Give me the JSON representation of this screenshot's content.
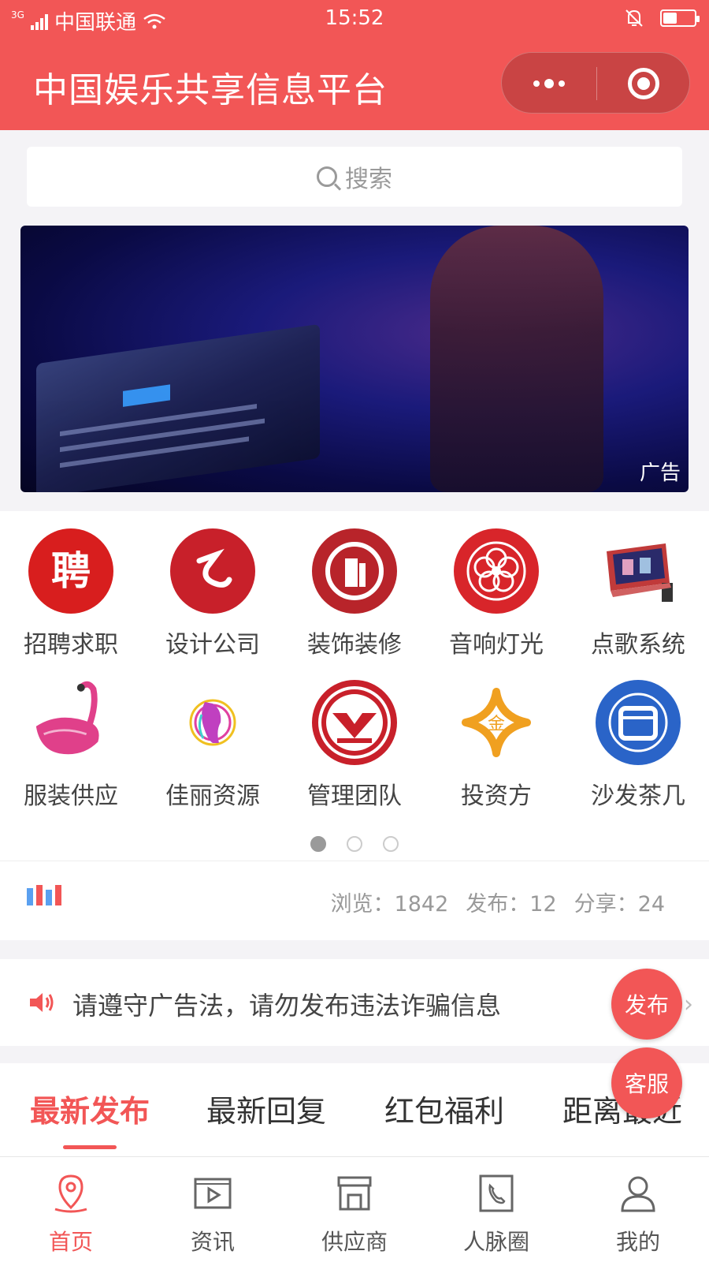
{
  "status_bar": {
    "network": "3G",
    "carrier": "中国联通",
    "time": "15:52",
    "battery_level": 0.45
  },
  "header": {
    "title": "中国娱乐共享信息平台",
    "menu_icon": "more-dots-icon",
    "close_icon": "target-icon"
  },
  "search": {
    "placeholder": "搜索"
  },
  "banner": {
    "ad_label": "广告"
  },
  "categories": [
    {
      "label": "招聘求职",
      "icon": "recruit-icon",
      "color": "#d81e1e"
    },
    {
      "label": "设计公司",
      "icon": "design-icon",
      "color": "#c8202a"
    },
    {
      "label": "装饰装修",
      "icon": "decoration-icon",
      "color": "#b8242a"
    },
    {
      "label": "音响灯光",
      "icon": "flower-icon",
      "color": "#d8252a"
    },
    {
      "label": "点歌系统",
      "icon": "karaoke-icon",
      "color": "#c03a3a"
    },
    {
      "label": "服装供应",
      "icon": "flamingo-icon",
      "color": "#e0408a"
    },
    {
      "label": "佳丽资源",
      "icon": "girl-icon",
      "color": "#c040c0"
    },
    {
      "label": "管理团队",
      "icon": "team-icon",
      "color": "#c8202a"
    },
    {
      "label": "投资方",
      "icon": "invest-icon",
      "color": "#f0a020"
    },
    {
      "label": "沙发茶几",
      "icon": "sofa-icon",
      "color": "#2a64c8"
    }
  ],
  "pager": {
    "total": 3,
    "current": 1
  },
  "stats": {
    "views": "浏览：1842",
    "posts": "发布：12",
    "shares": "分享：24"
  },
  "notice": {
    "text": "请遵守广告法，请勿发布违法诈骗信息"
  },
  "tabs": [
    {
      "label": "最新发布",
      "active": true
    },
    {
      "label": "最新回复",
      "active": false
    },
    {
      "label": "红包福利",
      "active": false
    },
    {
      "label": "距离最近",
      "active": false
    }
  ],
  "fab": {
    "publish": "发布",
    "service": "客服"
  },
  "bottom_nav": [
    {
      "label": "首页",
      "icon": "location-icon",
      "active": true
    },
    {
      "label": "资讯",
      "icon": "video-icon",
      "active": false
    },
    {
      "label": "供应商",
      "icon": "store-icon",
      "active": false
    },
    {
      "label": "人脉圈",
      "icon": "phone-book-icon",
      "active": false
    },
    {
      "label": "我的",
      "icon": "user-icon",
      "active": false
    }
  ],
  "colors": {
    "brand": "#f25656",
    "background": "#f4f3f6"
  }
}
